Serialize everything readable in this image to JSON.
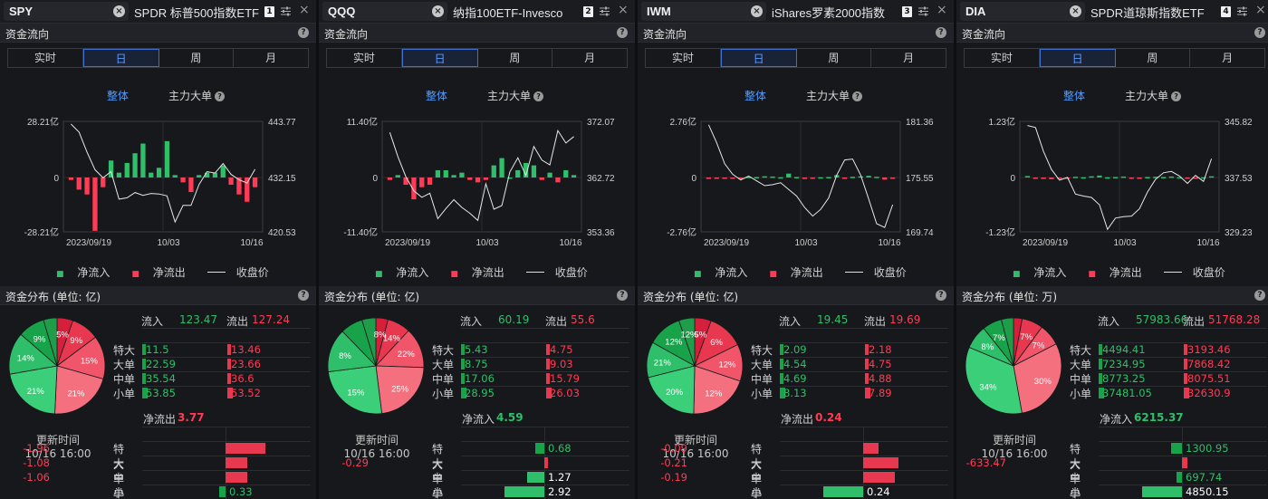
{
  "colors": {
    "inflow": "#2fbf6a",
    "outflow": "#ff3b55",
    "accent": "#4f9cff"
  },
  "tabs": [
    "实时",
    "日",
    "周",
    "月"
  ],
  "active_tab": 1,
  "sub_tabs": {
    "overall": "整体",
    "main": "主力大单"
  },
  "section_titles": {
    "flow": "资金流向"
  },
  "legend": {
    "in": "净流入",
    "out": "净流出",
    "close": "收盘价"
  },
  "labels": {
    "flow_in": "流入",
    "flow_out": "流出",
    "update": "更新时间",
    "net_in": "净流入",
    "net_out": "净流出"
  },
  "categories": [
    "特大",
    "大单",
    "中单",
    "小单"
  ],
  "panels": [
    {
      "ticker": "SPY",
      "name": "SPDR 标普500指数ETF",
      "num": "1",
      "dist_title": "资金分布 (单位: 亿)",
      "flow_in": "123.47",
      "flow_out": "127.24",
      "in_vals": [
        "11.5",
        "22.59",
        "35.54",
        "53.85"
      ],
      "out_vals": [
        "13.46",
        "23.66",
        "36.6",
        "53.52"
      ],
      "net_label": "净流出",
      "net_total": "3.77",
      "net_dir": "out",
      "net_vals": [
        "-1.96",
        "-1.08",
        "-1.06",
        "0.33"
      ],
      "update_time": "10/16 16:00",
      "pie_labels": [
        "5%",
        "9%",
        "15%",
        "21%",
        "21%",
        "14%",
        "9%"
      ],
      "chart_data": {
        "type": "bar",
        "left_ticks": [
          "28.21亿",
          "0",
          "-28.21亿"
        ],
        "right_ticks": [
          "443.77",
          "432.15",
          "420.53"
        ],
        "x_labels": [
          "2023/09/19",
          "10/03",
          "10/16"
        ],
        "left_range": [
          -28.21,
          28.21
        ],
        "right_range": [
          420.53,
          443.77
        ],
        "bars": [
          -1,
          -5,
          -7,
          -22,
          -4,
          7,
          2,
          6,
          10,
          14,
          2,
          4,
          15,
          1,
          -2,
          -6,
          1,
          2,
          2,
          5,
          -3,
          -7,
          -10,
          -4
        ],
        "close": [
          443.2,
          441.5,
          437.3,
          433.6,
          431.9,
          433.2,
          427.4,
          427.7,
          428.8,
          428.2,
          428.6,
          428.5,
          428.1,
          422.6,
          426.1,
          426.1,
          430.5,
          433.2,
          432.9,
          434.9,
          432.6,
          431.5,
          430.8,
          433.7
        ]
      }
    },
    {
      "ticker": "QQQ",
      "name": "纳指100ETF-Invesco",
      "num": "2",
      "dist_title": "资金分布 (单位: 亿)",
      "flow_in": "60.19",
      "flow_out": "55.6",
      "in_vals": [
        "5.43",
        "8.75",
        "17.06",
        "28.95"
      ],
      "out_vals": [
        "4.75",
        "9.03",
        "15.79",
        "26.03"
      ],
      "net_label": "净流入",
      "net_total": "4.59",
      "net_dir": "in",
      "net_vals": [
        "0.68",
        "-0.29",
        "1.27",
        "2.92"
      ],
      "update_time": "10/16 16:00",
      "pie_labels": [
        "8%",
        "14%",
        "22%",
        "25%",
        "15%",
        "8%"
      ],
      "chart_data": {
        "type": "bar",
        "left_ticks": [
          "11.40亿",
          "0",
          "-11.40亿"
        ],
        "right_ticks": [
          "372.07",
          "362.72",
          "353.36"
        ],
        "x_labels": [
          "2023/09/19",
          "10/03",
          "10/16"
        ],
        "left_range": [
          -11.4,
          11.4
        ],
        "right_range": [
          353.36,
          372.07
        ],
        "bars": [
          -1,
          1,
          -3,
          -9,
          -4,
          -3,
          3,
          3,
          1,
          2,
          -1,
          -2,
          -1,
          5,
          8,
          0,
          3,
          6,
          5,
          -1,
          2,
          -2,
          3,
          1
        ],
        "close": [
          370.2,
          366.1,
          362.7,
          360.3,
          359.2,
          359.9,
          355.6,
          357.3,
          358.8,
          357.5,
          356.5,
          355.3,
          361.5,
          357.2,
          357.8,
          363.5,
          365.9,
          362.9,
          367.8,
          365.5,
          364.7,
          370.5,
          368.4,
          369.5
        ]
      }
    },
    {
      "ticker": "IWM",
      "name": "iShares罗素2000指数",
      "num": "3",
      "dist_title": "资金分布 (单位: 亿)",
      "flow_in": "19.45",
      "flow_out": "19.69",
      "in_vals": [
        "2.09",
        "4.54",
        "4.69",
        "8.13"
      ],
      "out_vals": [
        "2.18",
        "4.75",
        "4.88",
        "7.89"
      ],
      "net_label": "净流出",
      "net_total": "0.24",
      "net_dir": "out",
      "net_vals": [
        "-0.09",
        "-0.21",
        "-0.19",
        "0.24"
      ],
      "update_time": "10/16 16:00",
      "pie_labels": [
        "5%",
        "6%",
        "12%",
        "12%",
        "20%",
        "21%",
        "12%",
        "12%"
      ],
      "chart_data": {
        "type": "bar",
        "left_ticks": [
          "2.76亿",
          "0",
          "-2.76亿"
        ],
        "right_ticks": [
          "181.36",
          "175.55",
          "169.74"
        ],
        "x_labels": [
          "2023/09/19",
          "10/03",
          "10/16"
        ],
        "left_range": [
          -2.76,
          2.76
        ],
        "right_range": [
          169.74,
          181.36
        ],
        "bars": [
          -0.6,
          -0.1,
          -0.1,
          -0.2,
          -0.7,
          0.3,
          0.2,
          0.5,
          0.4,
          0.1,
          1.6,
          0.2,
          -0.6,
          -0.4,
          0.1,
          0.2,
          1.0,
          -0.1,
          0.3,
          0.5,
          0.7,
          0.3,
          -0.9,
          -0.2
        ],
        "close": [
          181.0,
          179.1,
          176.9,
          175.8,
          175.2,
          175.6,
          175.1,
          174.6,
          174.7,
          174.9,
          174.2,
          173.5,
          172.3,
          171.4,
          172.1,
          173.3,
          175.7,
          177.3,
          177.4,
          175.7,
          173.2,
          170.6,
          170.2,
          172.6
        ]
      }
    },
    {
      "ticker": "DIA",
      "name": "SPDR道琼斯指数ETF",
      "num": "4",
      "dist_title": "资金分布 (单位: 万)",
      "flow_in": "57983.66",
      "flow_out": "51768.28",
      "in_vals": [
        "4494.41",
        "7234.95",
        "8773.25",
        "37481.05"
      ],
      "out_vals": [
        "3193.46",
        "7868.42",
        "8075.51",
        "32630.9"
      ],
      "net_label": "净流入",
      "net_total": "6215.37",
      "net_dir": "in",
      "net_vals": [
        "1300.95",
        "-633.47",
        "697.74",
        "4850.15"
      ],
      "update_time": "10/16 16:00",
      "pie_labels": [
        "7%",
        "7%",
        "30%",
        "34%",
        "8%",
        "7%"
      ],
      "chart_data": {
        "type": "bar",
        "left_ticks": [
          "1.23亿",
          "0",
          "-1.23亿"
        ],
        "right_ticks": [
          "345.82",
          "337.53",
          "329.23"
        ],
        "x_labels": [
          "2023/09/19",
          "10/03",
          "10/16"
        ],
        "left_range": [
          -1.23,
          1.23
        ],
        "right_range": [
          329.23,
          345.82
        ],
        "bars": [
          0.6,
          -0.4,
          -0.6,
          -0.7,
          -0.3,
          -0.1,
          0.3,
          0.1,
          0.5,
          0.8,
          0.1,
          0.2,
          0.4,
          -0.4,
          -0.3,
          0.2,
          0.3,
          0.2,
          0.4,
          0.1,
          -0.3,
          -0.3,
          0.1,
          0.5
        ],
        "close": [
          345.2,
          344.9,
          341.3,
          338.6,
          337.0,
          337.4,
          334.9,
          334.6,
          334.4,
          333.3,
          329.6,
          331.3,
          331.5,
          331.6,
          332.7,
          335.2,
          337.1,
          338.1,
          338.3,
          337.6,
          336.5,
          337.7,
          336.8,
          340.2
        ]
      }
    }
  ]
}
